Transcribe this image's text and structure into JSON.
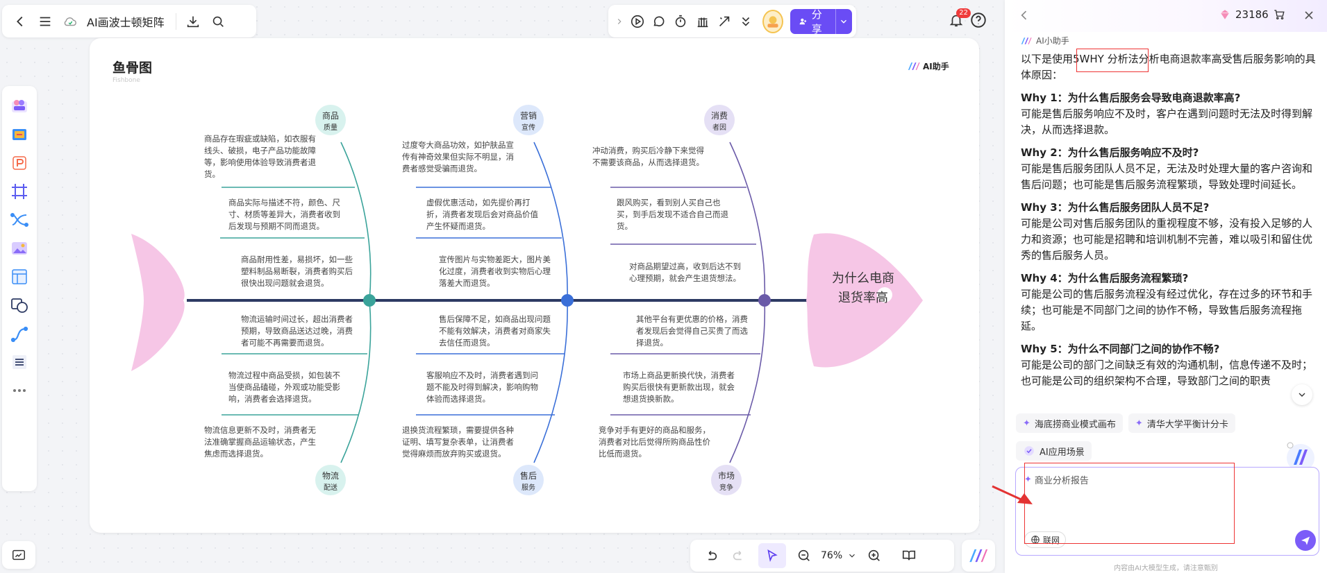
{
  "toolbar": {
    "doc_title": "AI画波士顿矩阵",
    "share_label": "分享",
    "notification_count": "22"
  },
  "canvas": {
    "title": "鱼骨图",
    "subtitle": "Fishbone",
    "ai_brand": "AI助手",
    "head_label_line1": "为什么电商",
    "head_label_line2": "退货率高",
    "categories": [
      {
        "l1": "商品",
        "l2": "质量"
      },
      {
        "l1": "营销",
        "l2": "宣传"
      },
      {
        "l1": "消费",
        "l2": "者因"
      },
      {
        "l1": "物流",
        "l2": "配送"
      },
      {
        "l1": "售后",
        "l2": "服务"
      },
      {
        "l1": "市场",
        "l2": "竞争"
      }
    ],
    "causes": [
      "商品存在瑕疵或缺陷，如衣服有线头、破损，电子产品功能故障等，影响使用体验导致消费者退货。",
      "商品实际与描述不符，颜色、尺寸、材质等差异大，消费者收到后发现与预期不同而退货。",
      "商品耐用性差，易损坏，如一些塑料制品易断裂，消费者购买后很快出现问题就会退货。",
      "物流运输时间过长，超出消费者预期，导致商品送达过晚，消费者可能不再需要而退货。",
      "物流过程中商品受损，如包装不当使商品磕碰，外观或功能受影响，消费者会选择退货。",
      "物流信息更新不及时，消费者无法准确掌握商品运输状态，产生焦虑而选择退货。",
      "过度夸大商品功效，如护肤品宣传有神奇效果但实际不明显，消费者感觉受骗而退货。",
      "虚假优惠活动，如先提价再打折，消费者发现后会对商品价值产生怀疑而退货。",
      "宣传图片与实物差距大，图片美化过度，消费者收到实物后心理落差大而退货。",
      "售后保障不足，如商品出现问题不能有效解决，消费者对商家失去信任而退货。",
      "客服响应不及时，消费者遇到问题不能及时得到解决，影响购物体验而选择退货。",
      "退换货流程繁琐，需要提供各种证明、填写复杂表单，让消费者觉得麻烦而放弃购买或退货。",
      "冲动消费，购买后冷静下来觉得不需要该商品，从而选择退货。",
      "跟风购买，看到别人买自己也买，到手后发现不适合自己而退货。",
      "对商品期望过高，收到后达不到心理预期，就会产生退货想法。",
      "其他平台有更优惠的价格，消费者发现后会觉得自己买贵了而选择退货。",
      "市场上商品更新换代快，消费者购买后很快有更新款出现，就会想退货换新款。",
      "竞争对手有更好的商品和服务，消费者对比后觉得所购商品性价比低而退货。"
    ]
  },
  "bottom": {
    "zoom": "76%"
  },
  "ai_panel": {
    "points": "23186",
    "assistant_name": "AI小助手",
    "intro_pre": "以下是使用",
    "intro_hl": "5WHY 分析法",
    "intro_post": "分析电商退款率高受售后服务影响的具体原因：",
    "whys": [
      {
        "q": "Why 1：为什么售后服务会导致电商退款率高?",
        "a": "可能是售后服务响应不及时，客户在遇到问题时无法及时得到解决，从而选择退款。"
      },
      {
        "q": "Why 2：为什么售后服务响应不及时?",
        "a": "可能是售后服务团队人员不足，无法及时处理大量的客户咨询和售后问题；也可能是售后服务流程繁琐，导致处理时间延长。"
      },
      {
        "q": "Why 3：为什么售后服务团队人员不足?",
        "a": "可能是公司对售后服务团队的重视程度不够，没有投入足够的人力和资源；也可能是招聘和培训机制不完善，难以吸引和留住优秀的售后服务人员。"
      },
      {
        "q": "Why 4：为什么售后服务流程繁琐?",
        "a": "可能是公司的售后服务流程没有经过优化，存在过多的环节和手续；也可能是不同部门之间的协作不畅，导致售后服务流程拖延。"
      },
      {
        "q": "Why 5：为什么不同部门之间的协作不畅?",
        "a": "可能是公司的部门之间缺乏有效的沟通机制，信息传递不及时；也可能是公司的组织架构不合理，导致部门之间的职责"
      }
    ],
    "chips": [
      "海底捞商业模式画布",
      "清华大学平衡计分卡"
    ],
    "scene_label": "AI应用场景",
    "input_tag": "商业分析报告",
    "input_placeholder": "",
    "net_label": "联网",
    "disclaimer": "内容由AI大模型生成，请注意甄别"
  },
  "colors": {
    "accent": "#6a4cf5",
    "fish_pink": "#f6c6e6",
    "spine": "#2d3a63",
    "teal": "#3aa39a",
    "blue": "#3a6fd8",
    "purple": "#6a5aa8",
    "annotation_red": "#e33333"
  }
}
